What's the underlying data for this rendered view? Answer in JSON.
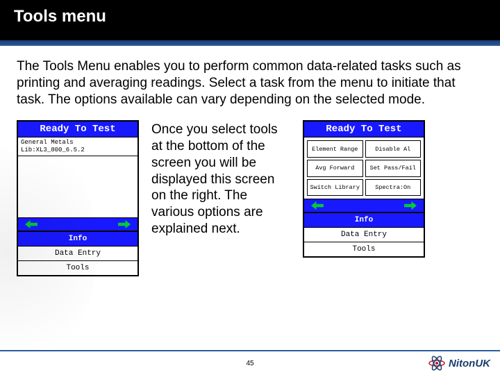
{
  "title": "Tools menu",
  "intro": "The Tools Menu enables you to perform common data-related tasks such as printing and averaging readings. Select a task from the menu to initiate that task. The options available can vary depending on the selected mode.",
  "middle_desc": "Once you select tools at the bottom of the screen you will be displayed this screen on the right. The various options are explained next.",
  "device_left": {
    "header": "Ready To Test",
    "sub_line1": "General Metals",
    "sub_line2": "Lib:XL3_800_6.5.2",
    "menu": {
      "info": "Info",
      "data_entry": "Data Entry",
      "tools": "Tools"
    }
  },
  "device_right": {
    "header": "Ready To Test",
    "buttons": {
      "b0": "Element Range",
      "b1": "Disable Al",
      "b2": "Avg Forward",
      "b3": "Set Pass/Fail",
      "b4": "Switch Library",
      "b5": "Spectra:On"
    },
    "menu": {
      "info": "Info",
      "data_entry": "Data Entry",
      "tools": "Tools"
    }
  },
  "page_number": "45",
  "brand": "NitonUK"
}
